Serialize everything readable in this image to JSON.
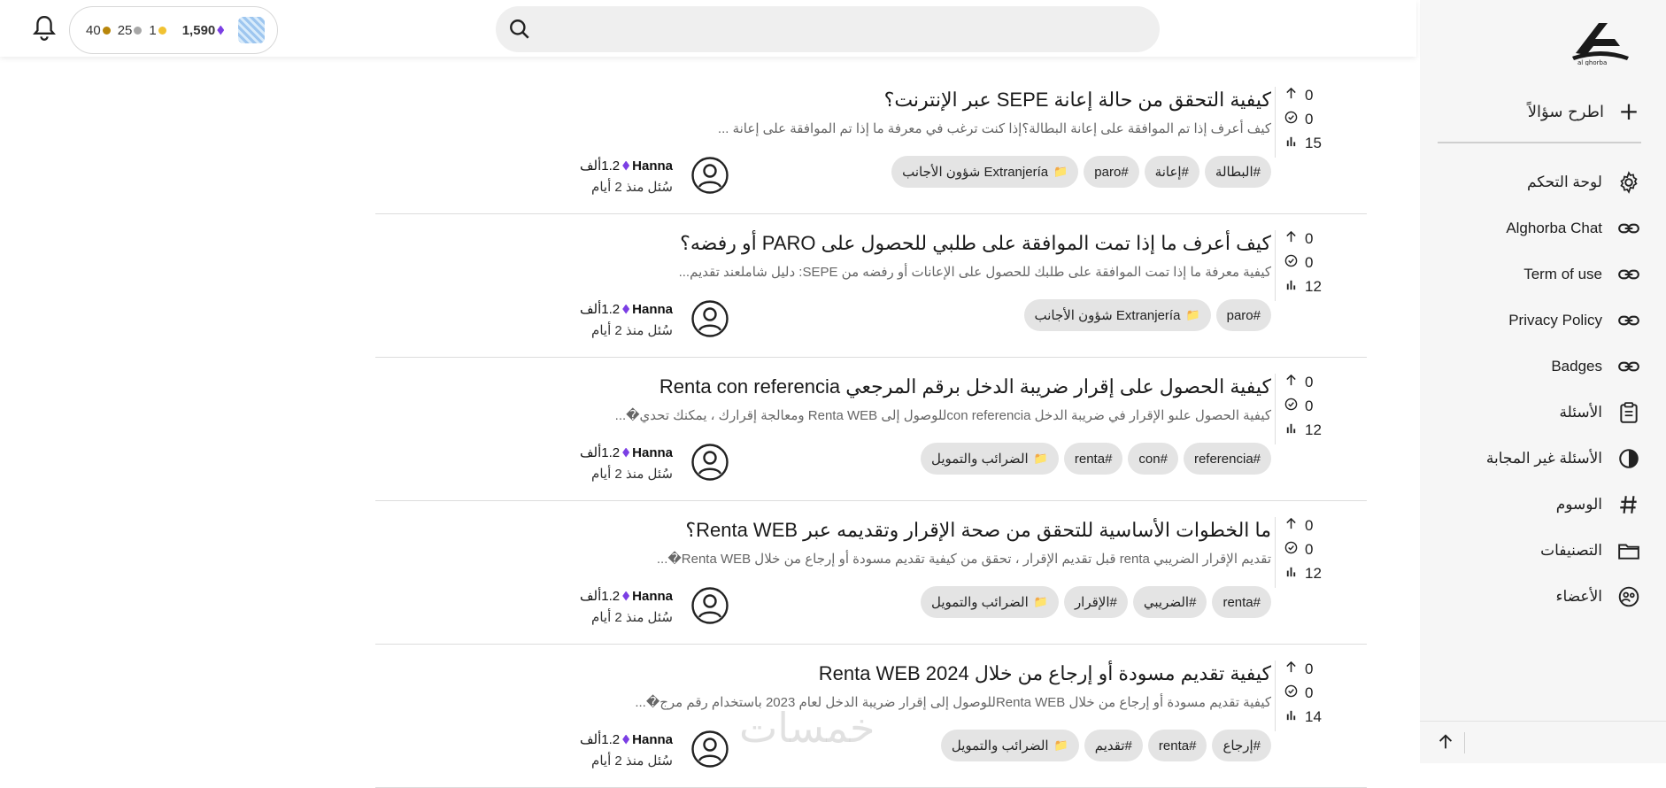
{
  "topbar": {
    "badges": {
      "bronze": "40",
      "silver": "25",
      "gold": "1"
    },
    "reputation": "1,590",
    "search_placeholder": ""
  },
  "colors": {
    "bronze": "#b8860b",
    "silver": "#a7a7a7",
    "gold": "#f1c232",
    "diamond": "#7b3fe4"
  },
  "sidebar": {
    "ask_label": "اطرح سؤالاً",
    "items": [
      {
        "label": "لوحة التحكم",
        "icon": "gear-icon"
      },
      {
        "label": "Alghorba Chat",
        "icon": "link-icon"
      },
      {
        "label": "Term of use",
        "icon": "link-icon"
      },
      {
        "label": "Privacy Policy",
        "icon": "link-icon"
      },
      {
        "label": "Badges",
        "icon": "link-icon"
      },
      {
        "label": "الأسئلة",
        "icon": "clipboard-icon"
      },
      {
        "label": "الأسئلة غير المجابة",
        "icon": "half-circle-icon"
      },
      {
        "label": "الوسوم",
        "icon": "hash-icon"
      },
      {
        "label": "التصنيفات",
        "icon": "folder-icon"
      },
      {
        "label": "الأعضاء",
        "icon": "users-icon"
      }
    ]
  },
  "watermark": "خمسات",
  "questions": [
    {
      "title": "كيفية التحقق من حالة إعانة SEPE عبر الإنترنت؟",
      "excerpt": "كيف أعرف إذا تم الموافقة على إعانة البطالة؟إذا كنت ترغب في معرفة ما إذا تم الموافقة على إعانة ...",
      "votes": "0",
      "answers": "0",
      "views": "15",
      "category": "Extranjería شؤون الأجانب",
      "tags": [
        "#paro",
        "#إعانة",
        "#البطالة"
      ],
      "author": "Hanna",
      "rep": "1.2ألف",
      "time": "سُئل منذ 2 أيام"
    },
    {
      "title": "كيف أعرف ما إذا تمت الموافقة على طلبي للحصول على PARO أو رفضه؟",
      "excerpt": "كيفية معرفة ما إذا تمت الموافقة على طلبك للحصول على الإعانات أو رفضه من SEPE: دليل شاملعند تقديم...",
      "votes": "0",
      "answers": "0",
      "views": "12",
      "category": "Extranjería شؤون الأجانب",
      "tags": [
        "#paro"
      ],
      "author": "Hanna",
      "rep": "1.2ألف",
      "time": "سُئل منذ 2 أيام"
    },
    {
      "title": "كيفية الحصول على إقرار ضريبة الدخل برقم المرجعي Renta con referencia",
      "excerpt": "كيفية الحصول علىو الإقرار في ضريبة الدخل con referenciaللوصول إلى Renta WEB ومعالجة إقرارك ، يمكنك تحدي�...",
      "votes": "0",
      "answers": "0",
      "views": "12",
      "category": "الضرائب والتمويل",
      "tags": [
        "#renta",
        "#con",
        "#referencia"
      ],
      "author": "Hanna",
      "rep": "1.2ألف",
      "time": "سُئل منذ 2 أيام"
    },
    {
      "title": "ما الخطوات الأساسية للتحقق من صحة الإقرار وتقديمه عبر Renta WEB؟",
      "excerpt": "تقديم الإقرار الضريبي renta قبل تقديم الإقرار ، تحقق من كيفية تقديم مسودة أو إرجاع من خلال Renta WEB�...",
      "votes": "0",
      "answers": "0",
      "views": "12",
      "category": "الضرائب والتمويل",
      "tags": [
        "#الإقرار",
        "#الضريبي",
        "#renta"
      ],
      "author": "Hanna",
      "rep": "1.2ألف",
      "time": "سُئل منذ 2 أيام"
    },
    {
      "title": "كيفية تقديم مسودة أو إرجاع من خلال Renta WEB 2024",
      "excerpt": "كيفية تقديم مسودة أو إرجاع من خلال Renta WEBللوصول إلى إقرار ضريبة الدخل لعام 2023 باستخدام رقم مرج�...",
      "votes": "0",
      "answers": "0",
      "views": "14",
      "category": "الضرائب والتمويل",
      "tags": [
        "#تقديم",
        "#renta",
        "#إرجاع"
      ],
      "author": "Hanna",
      "rep": "1.2ألف",
      "time": "سُئل منذ 2 أيام"
    }
  ]
}
